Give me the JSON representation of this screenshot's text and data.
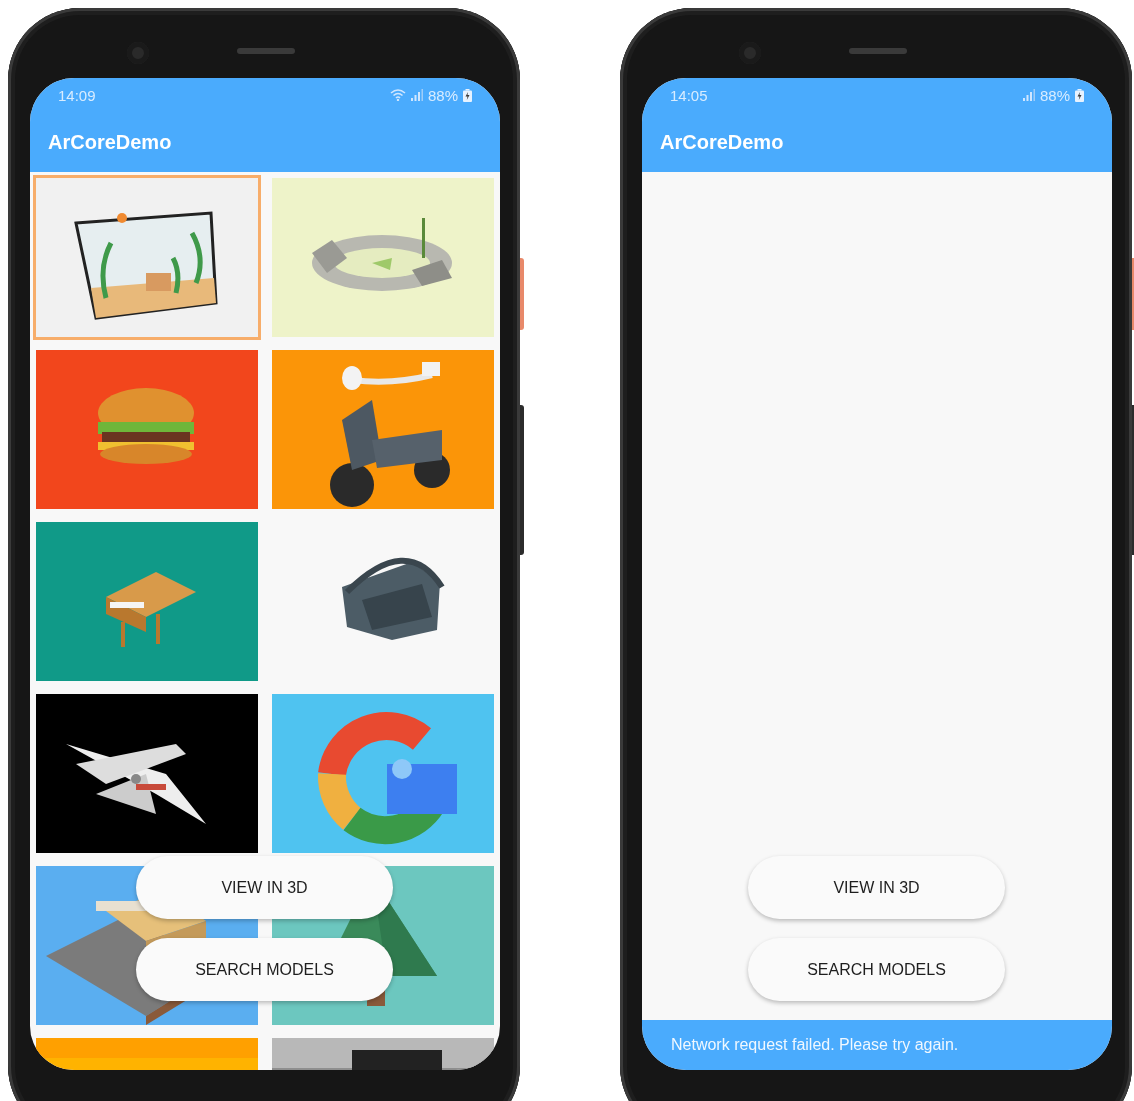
{
  "phones": [
    {
      "status_bar": {
        "time": "14:09",
        "wifi": true,
        "battery": "88%"
      },
      "app_bar": {
        "title": "ArCoreDemo"
      },
      "tiles": [
        {
          "kind": "picture",
          "selected": true
        },
        {
          "kind": "picture",
          "selected": false
        },
        {
          "kind": "picture",
          "selected": false
        },
        {
          "kind": "picture",
          "selected": false
        },
        {
          "kind": "picture",
          "selected": false
        },
        {
          "kind": "picture",
          "selected": false
        },
        {
          "kind": "picture",
          "selected": false
        },
        {
          "kind": "picture",
          "selected": false
        },
        {
          "kind": "picture",
          "selected": false
        },
        {
          "kind": "picture",
          "selected": false
        },
        {
          "kind": "picture",
          "selected": false
        },
        {
          "kind": "picture",
          "selected": false
        }
      ],
      "buttons": [
        "VIEW IN 3D",
        "SEARCH MODELS"
      ]
    },
    {
      "status_bar": {
        "time": "14:05",
        "wifi": false,
        "battery": "88%"
      },
      "app_bar": {
        "title": "ArCoreDemo"
      },
      "buttons": [
        "VIEW IN 3D",
        "SEARCH MODELS"
      ],
      "snackbar": {
        "message": "Network request failed. Please try again."
      }
    }
  ]
}
